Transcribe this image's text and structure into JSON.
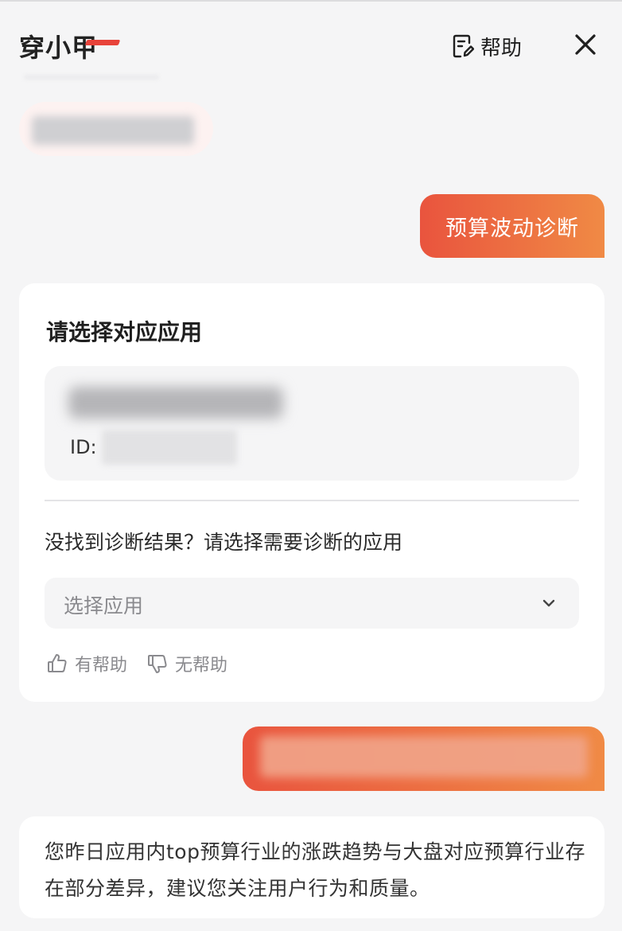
{
  "header": {
    "logo_text": "穿小甲",
    "help_label": "帮助",
    "brand_red": "#e8433a",
    "close_icon": "close-icon"
  },
  "messages": {
    "user_query": "预算波动诊断",
    "accent_gradient": [
      "#e9543e",
      "#f08a45"
    ]
  },
  "card": {
    "title": "请选择对应应用",
    "app_item": {
      "id_label": "ID:"
    },
    "not_found_text": "没找到诊断结果？请选择需要诊断的应用",
    "select": {
      "placeholder": "选择应用"
    },
    "feedback": {
      "helpful_label": "有帮助",
      "unhelpful_label": "无帮助"
    }
  },
  "answer": {
    "text": "您昨日应用内top预算行业的涨跌趋势与大盘对应预算行业存在部分差异，建议您关注用户行为和质量。"
  }
}
